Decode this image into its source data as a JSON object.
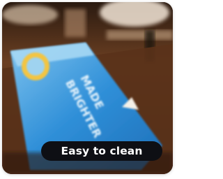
{
  "photo": {
    "description_icon": "bar-mat-photo",
    "mat_text_line1": "MADE",
    "mat_text_line2": "BRIGHTER",
    "colors": {
      "wood_dark": "#3b2212",
      "wood_mid": "#6b3f22",
      "mat_blue": "#2f8fd8",
      "mat_light": "#8fcbef",
      "badge_bg": "#0e0f14",
      "badge_text": "#ffffff"
    }
  },
  "badge": {
    "label": "Easy to clean"
  }
}
